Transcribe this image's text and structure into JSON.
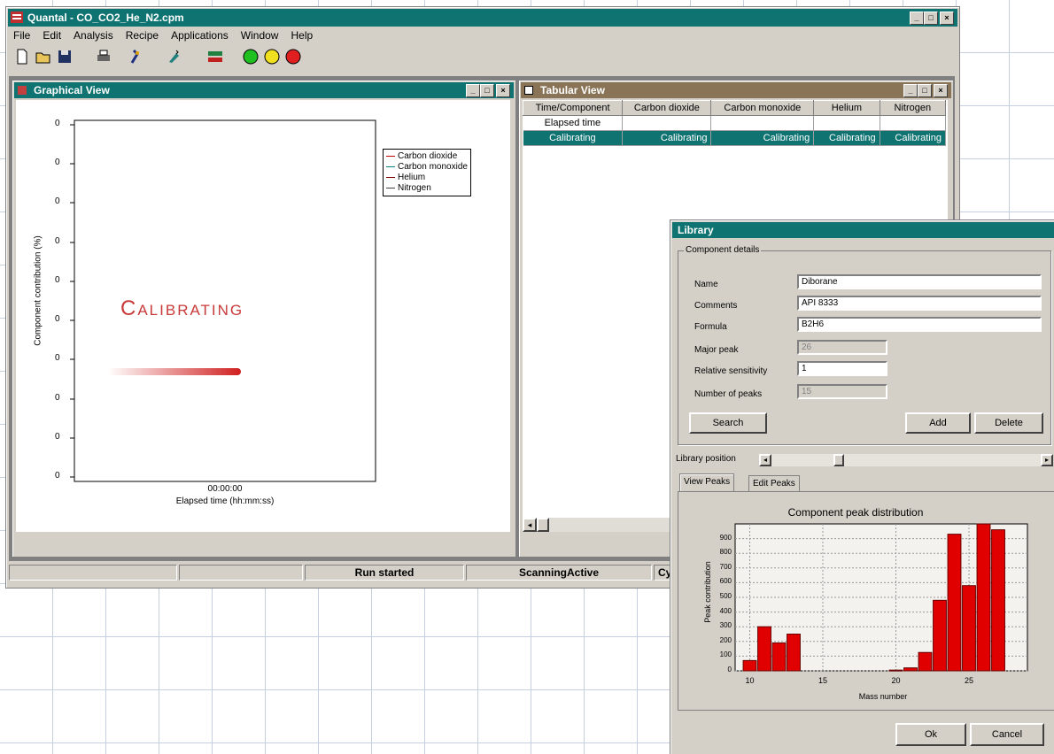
{
  "app": {
    "title": "Quantal - CO_CO2_He_N2.cpm",
    "menu": [
      "File",
      "Edit",
      "Analysis",
      "Recipe",
      "Applications",
      "Window",
      "Help"
    ],
    "toolbar_icons": [
      "new-icon",
      "open-icon",
      "save-icon",
      "print-icon",
      "tune-icon",
      "wizard-icon",
      "monitor-icon",
      "green-light-icon",
      "yellow-light-icon",
      "red-light-icon"
    ],
    "status": {
      "run": "Run started",
      "scanning": "ScanningActive",
      "cycle": "Cy"
    }
  },
  "graphical_view": {
    "title": "Graphical View",
    "legend": [
      {
        "name": "Carbon dioxide",
        "color": "#c00000"
      },
      {
        "name": "Carbon monoxide",
        "color": "#008080"
      },
      {
        "name": "Helium",
        "color": "#800000"
      },
      {
        "name": "Nitrogen",
        "color": "#404040"
      }
    ],
    "y_axis_label": "Component contribution (%)",
    "x_axis_label": "Elapsed time (hh:mm:ss)",
    "x_tick": "00:00:00",
    "y_ticks": [
      "0",
      "0",
      "0",
      "0",
      "0",
      "0",
      "0",
      "0",
      "0",
      "0"
    ],
    "overlay": "Calibrating",
    "overlay_color": "#c83a3a"
  },
  "tabular_view": {
    "title": "Tabular View",
    "columns": [
      "Time/Component",
      "Carbon dioxide",
      "Carbon monoxide",
      "Helium",
      "Nitrogen"
    ],
    "rows": [
      [
        "Elapsed time",
        "",
        "",
        "",
        ""
      ],
      [
        "Calibrating",
        "Calibrating",
        "Calibrating",
        "Calibrating",
        "Calibrating"
      ]
    ],
    "selected_color": "#0f7371"
  },
  "library": {
    "title": "Library",
    "group": "Component details",
    "fields": {
      "name_label": "Name",
      "name_value": "Diborane",
      "comments_label": "Comments",
      "comments_value": "API 8333",
      "formula_label": "Formula",
      "formula_value": "B2H6",
      "major_peak_label": "Major peak",
      "major_peak_value": "26",
      "rel_sens_label": "Relative sensitivity",
      "rel_sens_value": "1",
      "num_peaks_label": "Number of peaks",
      "num_peaks_value": "15"
    },
    "buttons": {
      "search": "Search",
      "add": "Add",
      "delete": "Delete",
      "ok": "Ok",
      "cancel": "Cancel"
    },
    "position_label": "Library position",
    "position_fraction": 0.24,
    "tabs": [
      "View Peaks",
      "Edit Peaks"
    ]
  },
  "chart_data": {
    "type": "bar",
    "title": "Component peak distribution",
    "xlabel": "Mass number",
    "ylabel": "Peak contribution",
    "x_ticks": [
      10,
      15,
      20,
      25
    ],
    "y_ticks": [
      0,
      100,
      200,
      300,
      400,
      500,
      600,
      700,
      800,
      900
    ],
    "y_tick_labels": [
      "0",
      "100",
      "200",
      "300",
      "400",
      "500",
      "600",
      "700",
      "800",
      "900"
    ],
    "xlim": [
      9,
      29
    ],
    "ylim": [
      0,
      1000
    ],
    "color": "#e00000",
    "bars": [
      {
        "x": 10,
        "y": 70
      },
      {
        "x": 11,
        "y": 300
      },
      {
        "x": 12,
        "y": 190
      },
      {
        "x": 13,
        "y": 250
      },
      {
        "x": 20,
        "y": 5
      },
      {
        "x": 21,
        "y": 20
      },
      {
        "x": 22,
        "y": 125
      },
      {
        "x": 23,
        "y": 480
      },
      {
        "x": 24,
        "y": 930
      },
      {
        "x": 25,
        "y": 580
      },
      {
        "x": 26,
        "y": 1000
      },
      {
        "x": 27,
        "y": 960
      }
    ]
  }
}
